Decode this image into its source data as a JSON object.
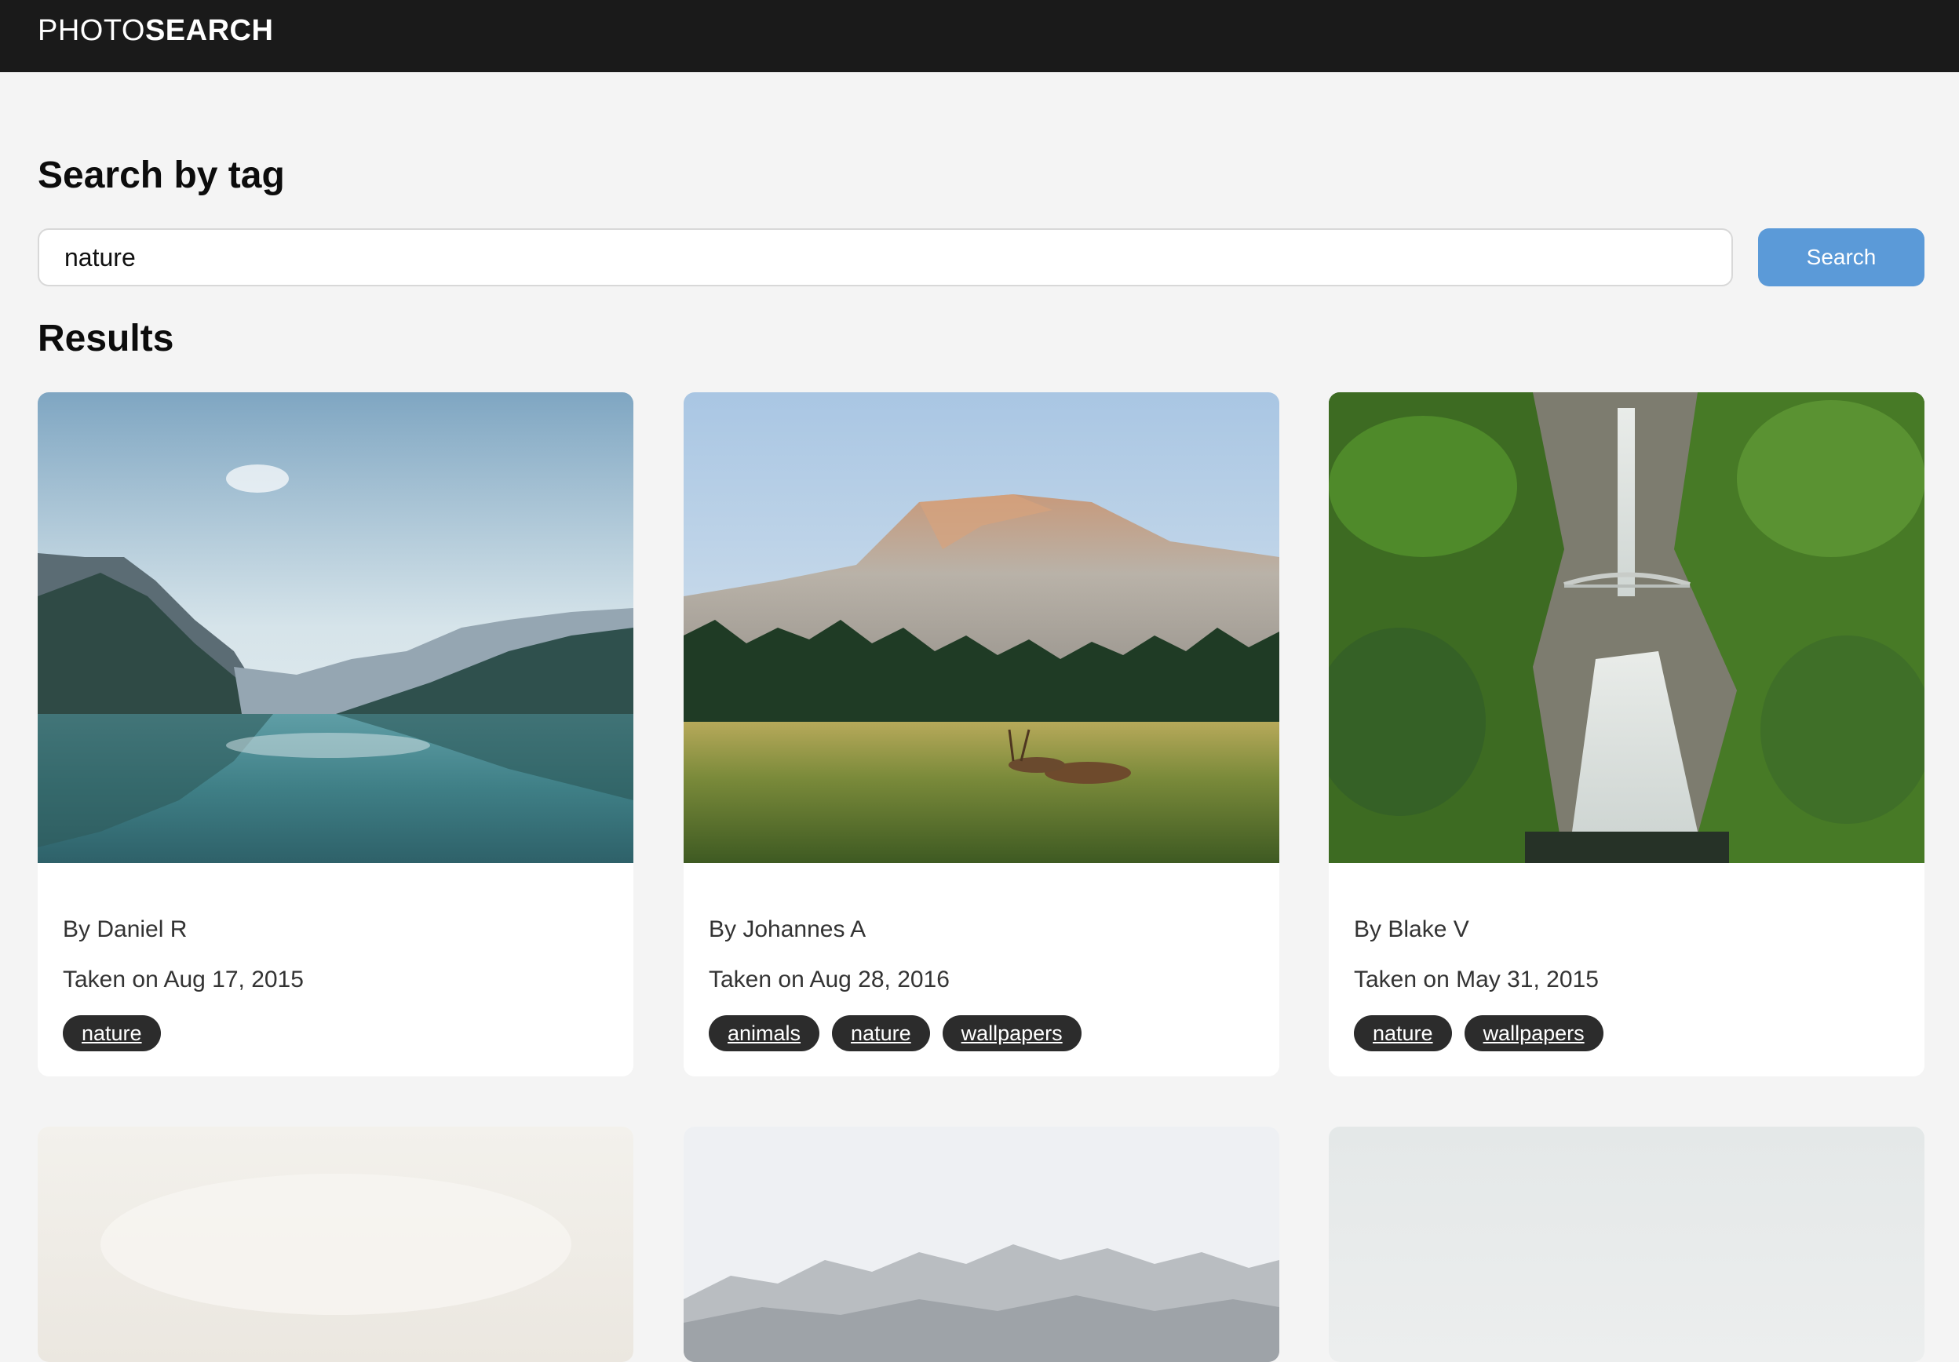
{
  "header": {
    "brand_light": "PHOTO",
    "brand_bold": "SEARCH"
  },
  "search": {
    "heading": "Search by tag",
    "value": "nature",
    "placeholder": "",
    "button_label": "Search"
  },
  "results": {
    "heading": "Results",
    "cards": [
      {
        "author": "By Daniel R",
        "date": "Taken on Aug 17, 2015",
        "tags": [
          "nature"
        ],
        "image": "mountain-lake-photo"
      },
      {
        "author": "By Johannes A",
        "date": "Taken on Aug 28, 2016",
        "tags": [
          "animals",
          "nature",
          "wallpapers"
        ],
        "image": "half-dome-meadow-deer-photo"
      },
      {
        "author": "By Blake V",
        "date": "Taken on May 31, 2015",
        "tags": [
          "nature",
          "wallpapers"
        ],
        "image": "waterfall-bridge-photo"
      },
      {
        "image": "misty-hazy-photo"
      },
      {
        "image": "snowy-ridge-photo"
      },
      {
        "image": "foggy-pale-photo"
      }
    ]
  },
  "colors": {
    "topbar": "#1a1a1a",
    "accent": "#5b9ad8",
    "tag_bg": "#2c2c2c",
    "page_bg": "#f4f4f4"
  }
}
